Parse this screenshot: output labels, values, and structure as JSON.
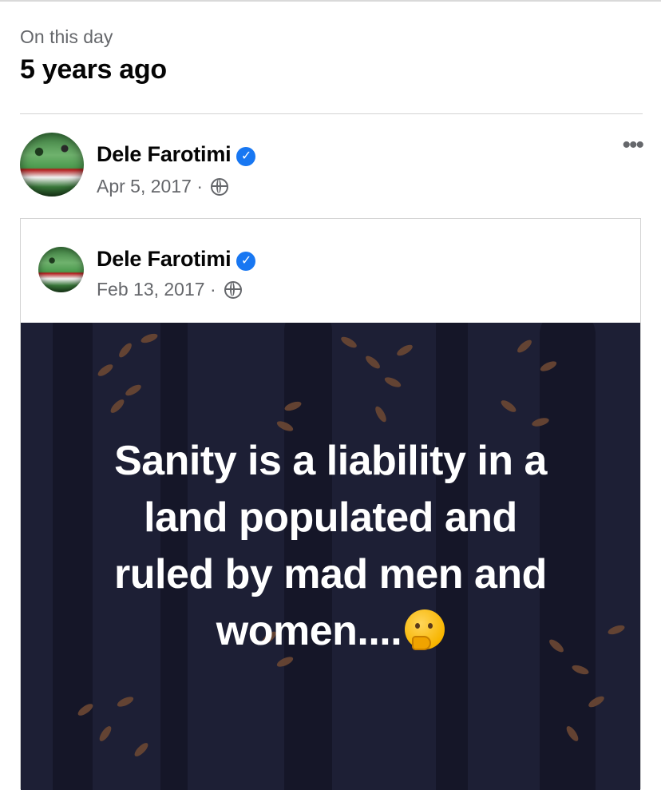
{
  "memory": {
    "subtitle": "On this day",
    "title": "5 years ago"
  },
  "post": {
    "author": "Dele Farotimi",
    "date": "Apr 5, 2017",
    "separator": "·",
    "more_label": "•••",
    "verified_icon": "verified-badge-icon",
    "privacy_icon": "globe-icon"
  },
  "shared_post": {
    "author": "Dele Farotimi",
    "date": "Feb 13, 2017",
    "separator": "·",
    "quote_lines": [
      "Sanity is a liability in a",
      "land populated and",
      "ruled by mad men and",
      "women...."
    ],
    "quote_emoji": "thinking-face-icon",
    "background_color": "#1d1f35"
  },
  "colors": {
    "accent": "#1877f2",
    "secondary_text": "#65676b",
    "leaf": "#6b4733"
  }
}
